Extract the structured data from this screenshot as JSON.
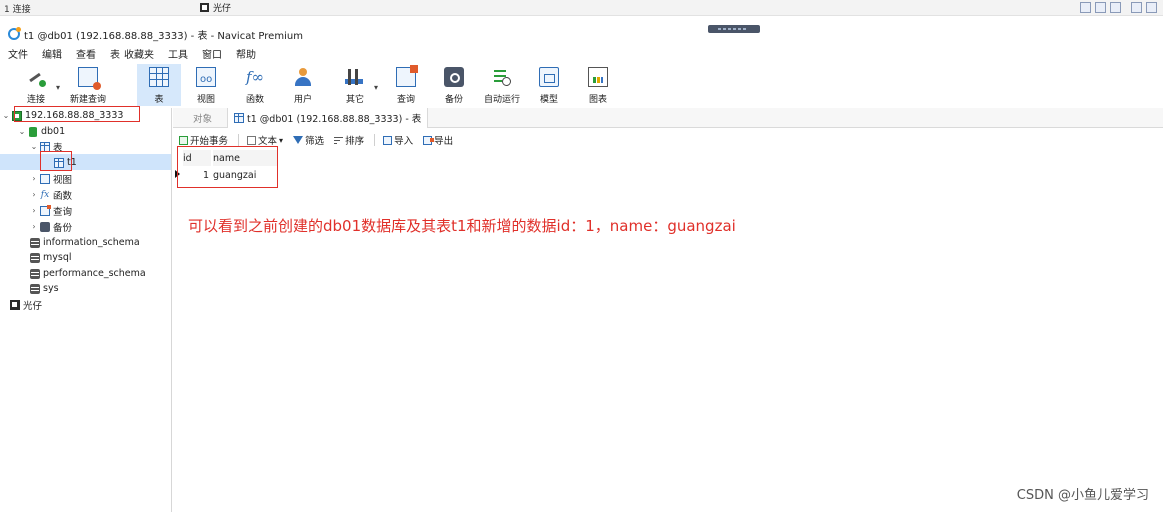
{
  "top_strip": {
    "connections": "1 连接",
    "current_label": "光仔",
    "view_buttons": [
      "grid-view",
      "list-view",
      "detail-view",
      "panel-left",
      "panel-right"
    ]
  },
  "window": {
    "title": "t1 @db01 (192.168.88.88_3333) - 表 - Navicat Premium"
  },
  "menu": [
    "文件",
    "编辑",
    "查看",
    "表",
    "收藏夹",
    "工具",
    "窗口",
    "帮助"
  ],
  "toolbar": [
    {
      "label": "连接",
      "icon": "connect-icon"
    },
    {
      "label": "新建查询",
      "icon": "new-query-icon"
    },
    {
      "label": "表",
      "icon": "table-icon",
      "active": true
    },
    {
      "label": "视图",
      "icon": "view-icon"
    },
    {
      "label": "函数",
      "icon": "function-icon"
    },
    {
      "label": "用户",
      "icon": "user-icon"
    },
    {
      "label": "其它",
      "icon": "other-icon"
    },
    {
      "label": "查询",
      "icon": "query-icon"
    },
    {
      "label": "备份",
      "icon": "backup-icon"
    },
    {
      "label": "自动运行",
      "icon": "auto-run-icon"
    },
    {
      "label": "模型",
      "icon": "model-icon"
    },
    {
      "label": "图表",
      "icon": "chart-icon"
    }
  ],
  "tree": {
    "connection": "192.168.88.88_3333",
    "database": "db01",
    "tables_group": "表",
    "selected_table": "t1",
    "views_group": "视图",
    "functions_group": "函数",
    "queries_group": "查询",
    "backups_group": "备份",
    "other_dbs": [
      "information_schema",
      "mysql",
      "performance_schema",
      "sys"
    ],
    "other_connection": "光仔"
  },
  "tabs": {
    "objects": "对象",
    "current": "t1 @db01 (192.168.88.88_3333) - 表"
  },
  "subtoolbar": {
    "begin_tx": "开始事务",
    "text": "文本",
    "filter": "筛选",
    "sort": "排序",
    "import": "导入",
    "export": "导出"
  },
  "grid": {
    "columns": [
      "id",
      "name"
    ],
    "rows": [
      [
        "1",
        "guangzai"
      ]
    ]
  },
  "annotation": "可以看到之前创建的db01数据库及其表t1和新增的数据id：1，name：guangzai",
  "watermark": "CSDN @小鱼儿爱学习"
}
